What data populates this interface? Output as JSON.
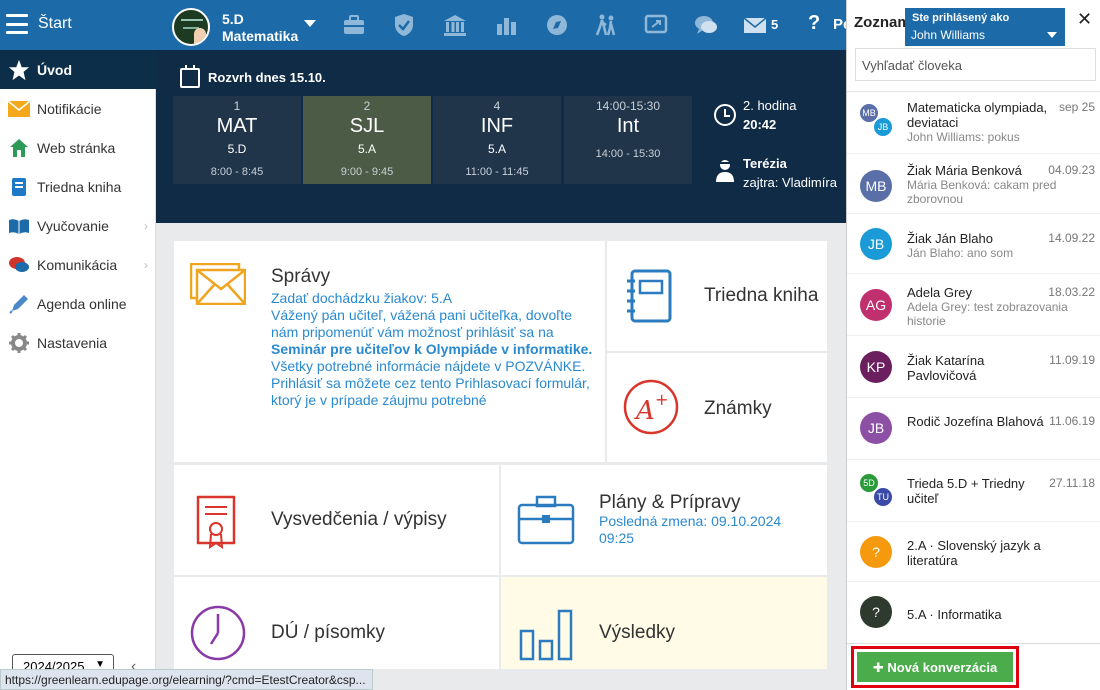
{
  "topbar": {
    "start_label": "Štart",
    "class_name": "5.D",
    "class_subject": "Matematika",
    "mail_count": "5",
    "help": "?",
    "profile_label": "Pe"
  },
  "sidebar": {
    "items": [
      {
        "label": "Úvod",
        "icon": "star-icon"
      },
      {
        "label": "Notifikácie",
        "icon": "envelope-icon"
      },
      {
        "label": "Web stránka",
        "icon": "home-icon"
      },
      {
        "label": "Triedna kniha",
        "icon": "book-icon"
      },
      {
        "label": "Vyučovanie",
        "icon": "open-book-icon"
      },
      {
        "label": "Komunikácia",
        "icon": "chat-icon"
      },
      {
        "label": "Agenda online",
        "icon": "pen-icon"
      },
      {
        "label": "Nastavenia",
        "icon": "gear-icon"
      }
    ],
    "school_year": "2024/2025"
  },
  "schedule": {
    "title": "Rozvrh dnes 15.10.",
    "lessons": [
      {
        "num": "1",
        "subject": "MAT",
        "class": "5.D",
        "time": "8:00 - 8:45"
      },
      {
        "num": "2",
        "subject": "SJL",
        "class": "5.A",
        "time": "9:00 - 9:45"
      },
      {
        "num": "4",
        "subject": "INF",
        "class": "5.A",
        "time": "11:00 - 11:45"
      },
      {
        "num": "14:00-15:30",
        "subject": "Int",
        "class": "",
        "time": "14:00 - 15:30"
      }
    ],
    "current_hour": "2. hodina",
    "current_time": "20:42",
    "duty_name": "Terézia",
    "duty_next": "zajtra: Vladimíra"
  },
  "tiles": {
    "messages": {
      "title": "Správy",
      "line1": "Zadať dochádzku žiakov: 5.A",
      "body_start": "Vážený pán učiteľ, vážená pani učiteľka, dovoľte nám pripomenúť vám možnosť prihlásiť sa na ",
      "body_bold": "Seminár pre učiteľov k Olympiáde v informatike.",
      "body_line2": "Všetky potrebné informácie nájdete v POZVÁNKE.",
      "body_line3": "Prihlásiť sa môžete cez tento Prihlasovací formulár, ktorý je v prípade záujmu potrebné"
    },
    "class_book": {
      "title": "Triedna kniha"
    },
    "grades": {
      "title": "Známky"
    },
    "certificates": {
      "title": "Vysvedčenia / výpisy"
    },
    "plans": {
      "title": "Plány & Prípravy",
      "sub": "Posledná zmena: 09.10.2024 09:25"
    },
    "homework": {
      "title": "DÚ / písomky"
    },
    "results": {
      "title": "Výsledky"
    }
  },
  "right_panel": {
    "title": "Zoznam",
    "logged_label": "Ste prihlásený ako",
    "logged_user": "John Williams",
    "search_placeholder": "Vyhľadať človeka",
    "conversations": [
      {
        "name": "Matematicka olympiada, deviataci",
        "date": "sep 25",
        "msg": "John Williams: pokus",
        "av1": "MB",
        "av2": "JB",
        "c1": "#5a6fa8",
        "c2": "#1a9ad6"
      },
      {
        "name": "Žiak Mária Benková",
        "date": "04.09.23",
        "msg": "Mária Benková: cakam pred zborovnou",
        "av": "MB",
        "color": "#5a6fa8"
      },
      {
        "name": "Žiak Ján Blaho",
        "date": "14.09.22",
        "msg": "Ján Blaho: ano som",
        "av": "JB",
        "color": "#1a9ad6"
      },
      {
        "name": "Adela Grey",
        "date": "18.03.22",
        "msg": "Adela Grey: test zobrazovania historie",
        "av": "AG",
        "color": "#c0306f"
      },
      {
        "name": "Žiak Katarína Pavlovičová",
        "date": "11.09.19",
        "msg": "",
        "av": "KP",
        "color": "#6b1f5e"
      },
      {
        "name": "Rodič Jozefína Blahová",
        "date": "11.06.19",
        "msg": "",
        "av": "JB",
        "color": "#8b4fa3"
      },
      {
        "name": "Trieda 5.D + Triedny učiteľ",
        "date": "27.11.18",
        "msg": "",
        "av1": "5D",
        "av2": "TU",
        "c1": "#2a9a3a",
        "c2": "#3a4aa8"
      },
      {
        "name": "2.A · Slovenský jazyk a literatúra",
        "date": "",
        "msg": "",
        "av": "?",
        "color": "#f59a0e"
      },
      {
        "name": "5.A · Informatika",
        "date": "",
        "msg": "",
        "av": "?",
        "color": "#2d3a2d"
      }
    ],
    "new_conversation": "Nová konverzácia"
  },
  "statusbar": {
    "url": "https://greenlearn.edupage.org/elearning/?cmd=EtestCreator&csp..."
  }
}
